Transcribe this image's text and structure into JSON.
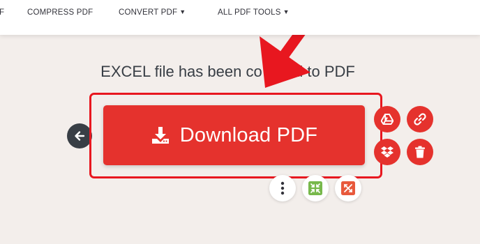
{
  "nav": {
    "items": [
      {
        "label": "F",
        "has_dropdown": false
      },
      {
        "label": "COMPRESS PDF",
        "has_dropdown": false
      },
      {
        "label": "CONVERT PDF",
        "has_dropdown": true
      },
      {
        "label": "ALL PDF TOOLS",
        "has_dropdown": true
      }
    ],
    "caret": "▼"
  },
  "result": {
    "title_prefix": "EXCEL file has been co",
    "title_suffix": "ted to PDF"
  },
  "download": {
    "label": "Download PDF",
    "icon": "download-icon"
  },
  "actions": {
    "back": "arrow-left-icon",
    "side": [
      "google-drive-icon",
      "link-icon",
      "dropbox-icon",
      "trash-icon"
    ],
    "extra": [
      "more-options-icon",
      "compress-icon",
      "split-icon"
    ]
  },
  "colors": {
    "accent": "#e5322d",
    "highlight": "#e8171f",
    "background": "#f3eeeb",
    "dark": "#383e45",
    "compress_icon": "#77b84b",
    "split_icon": "#e8593c"
  }
}
